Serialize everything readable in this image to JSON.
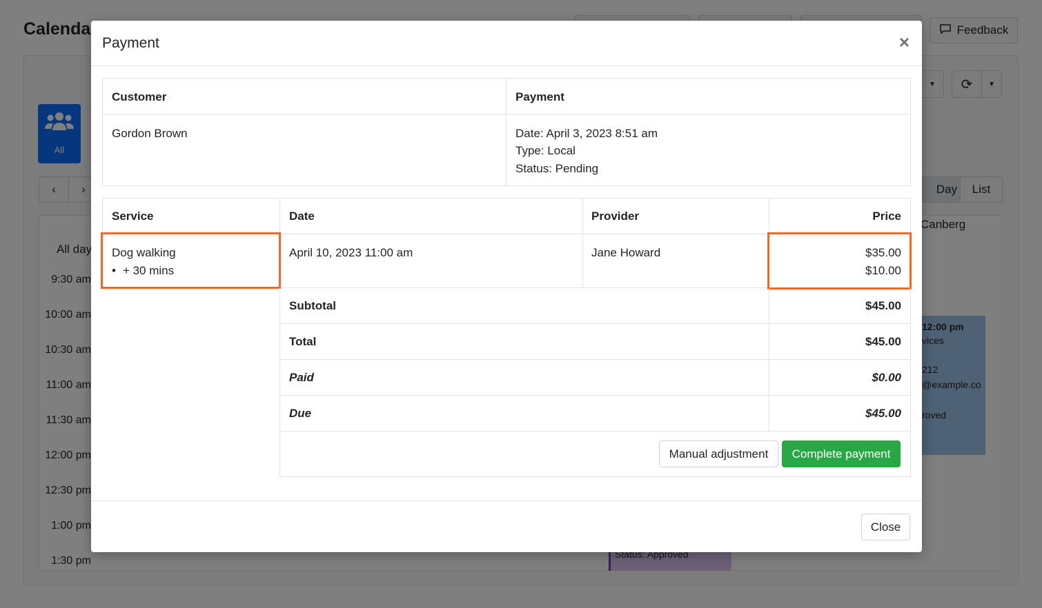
{
  "app": {
    "title": "Calendar",
    "feedback_label": "Feedback",
    "all_label": "All",
    "view_day": "Day",
    "view_list": "List",
    "column_header_partial": "Canberg",
    "all_day_label": "All day",
    "times": [
      "9:30 am",
      "10:00 am",
      "10:30 am",
      "11:00 am",
      "11:30 am",
      "12:00 pm",
      "12:30 pm",
      "1:00 pm",
      "1:30 pm"
    ],
    "event_blue": {
      "time": "12:00 pm",
      "line2": "vices",
      "line3": "212",
      "line4": "@example.co",
      "line5": "roved"
    },
    "event_purple_status": "Status: Approved"
  },
  "modal": {
    "title": "Payment",
    "close_symbol": "×",
    "info_table": {
      "customer_header": "Customer",
      "payment_header": "Payment",
      "customer_name": "Gordon Brown",
      "payment_date": "Date: April 3, 2023 8:51 am",
      "payment_type": "Type: Local",
      "payment_status": "Status: Pending"
    },
    "service_table": {
      "headers": {
        "service": "Service",
        "date": "Date",
        "provider": "Provider",
        "price": "Price"
      },
      "row": {
        "service": "Dog walking",
        "addon": "+ 30 mins",
        "date": "April 10, 2023 11:00 am",
        "provider": "Jane Howard",
        "price_main": "$35.00",
        "price_addon": "$10.00"
      },
      "subtotal_label": "Subtotal",
      "subtotal_value": "$45.00",
      "total_label": "Total",
      "total_value": "$45.00",
      "paid_label": "Paid",
      "paid_value": "$0.00",
      "due_label": "Due",
      "due_value": "$45.00"
    },
    "manual_adjustment_label": "Manual adjustment",
    "complete_payment_label": "Complete payment",
    "close_label": "Close"
  }
}
